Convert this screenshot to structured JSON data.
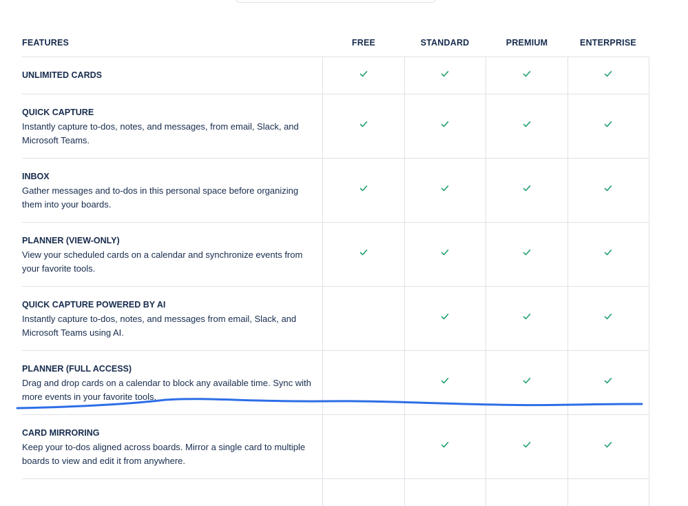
{
  "header": {
    "feature_col": "FEATURES",
    "plans": [
      "FREE",
      "STANDARD",
      "PREMIUM",
      "ENTERPRISE"
    ]
  },
  "rows": [
    {
      "title": "UNLIMITED CARDS",
      "desc": "",
      "checks": [
        true,
        true,
        true,
        true
      ]
    },
    {
      "title": "QUICK CAPTURE",
      "desc": "Instantly capture to-dos, notes, and messages, from email, Slack, and Microsoft Teams.",
      "checks": [
        true,
        true,
        true,
        true
      ]
    },
    {
      "title": "INBOX",
      "desc": "Gather messages and to-dos in this personal space before organizing them into your boards.",
      "checks": [
        true,
        true,
        true,
        true
      ]
    },
    {
      "title": "PLANNER (VIEW-ONLY)",
      "desc": "View your scheduled cards on a calendar and synchronize events from your favorite tools.",
      "checks": [
        true,
        true,
        true,
        true
      ]
    },
    {
      "title": "QUICK CAPTURE POWERED BY AI",
      "desc": "Instantly capture to-dos, notes, and messages from email, Slack, and Microsoft Teams using AI.",
      "checks": [
        false,
        true,
        true,
        true
      ]
    },
    {
      "title": "PLANNER (FULL ACCESS)",
      "desc": "Drag and drop cards on a calendar to block any available time. Sync with more events in your favorite tools.",
      "checks": [
        false,
        true,
        true,
        true
      ]
    },
    {
      "title": "CARD MIRRORING",
      "desc": "Keep your to-dos aligned across boards. Mirror a single card to multiple boards to view and edit it from anywhere.",
      "checks": [
        false,
        true,
        true,
        true
      ]
    },
    {
      "title": "",
      "desc": "",
      "checks": [
        false,
        false,
        false,
        false
      ]
    }
  ],
  "icons": {
    "check": "check-icon"
  },
  "colors": {
    "check": "#22a06b",
    "annotation": "#2d6ee6",
    "border": "#dfe1e6",
    "text": "#172b4d"
  }
}
